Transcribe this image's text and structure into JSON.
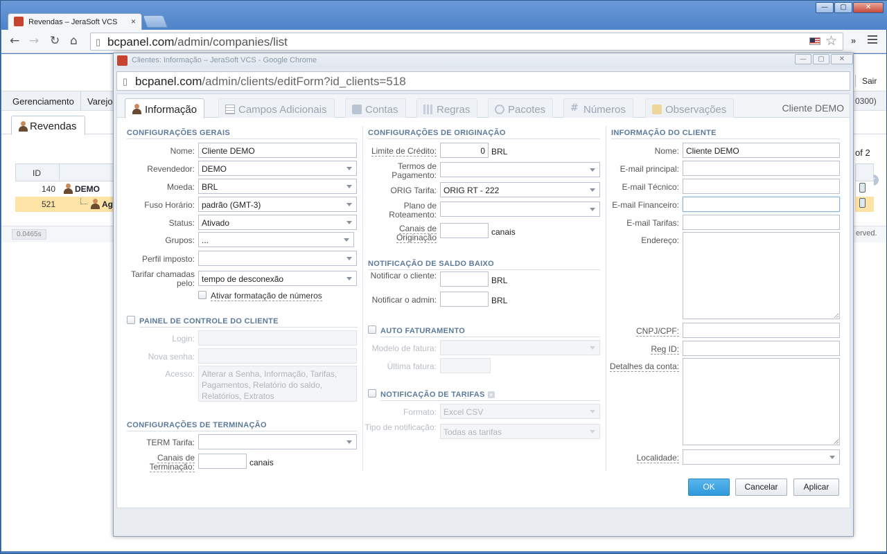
{
  "browser": {
    "tab_title": "Revendas – JeraSoft VCS",
    "url_host": "bcpanel.com",
    "url_path": "/admin/companies/list",
    "window_buttons": [
      "—",
      "▢",
      "✕"
    ]
  },
  "background_page": {
    "logout": "Sair",
    "menu": [
      "Gerenciamento",
      "Varejo"
    ],
    "right_code": "0300)",
    "tab": "Revendas",
    "pagination_tail": "of 2",
    "table": {
      "header_id": "ID",
      "rows": [
        {
          "id": "140",
          "name": "DEMO"
        },
        {
          "id": "521",
          "name": "Ag"
        }
      ]
    },
    "time": "0.0465s",
    "footer_right": "erved."
  },
  "popup": {
    "title": "Clientes: Informação – JeraSoft VCS - Google Chrome",
    "url_host": "bcpanel.com",
    "url_path": "/admin/clients/editForm?id_clients=518",
    "client_name": "Cliente DEMO",
    "tabs": [
      "Informação",
      "Campos Adicionais",
      "Contas",
      "Regras",
      "Pacotes",
      "Números",
      "Observações"
    ],
    "general": {
      "title": "CONFIGURAÇÕES GERAIS",
      "name_label": "Nome:",
      "name_value": "Cliente DEMO",
      "reseller_label": "Revendedor:",
      "reseller_value": "DEMO",
      "currency_label": "Moeda:",
      "currency_value": "BRL",
      "tz_label": "Fuso Horário:",
      "tz_value": "padrão (GMT-3)",
      "status_label": "Status:",
      "status_value": "Ativado",
      "groups_label": "Grupos:",
      "groups_value": "...",
      "tax_label": "Perfil imposto:",
      "tax_value": "",
      "billing_label": "Tarifar chamadas pelo:",
      "billing_value": "tempo de desconexão",
      "format_checkbox": "Ativar formatação de números"
    },
    "panel": {
      "title": "PAINEL DE CONTROLE DO CLIENTE",
      "login_label": "Login:",
      "password_label": "Nova senha:",
      "access_label": "Acesso:",
      "access_value": "Alterar a Senha, Informação, Tarifas, Pagamentos, Relatório do saldo, Relatórios, Extratos"
    },
    "termination": {
      "title": "CONFIGURAÇÕES DE TERMINAÇÃO",
      "rate_label": "TERM Tarifa:",
      "rate_value": "",
      "channels_label": "Canais de Terminação:",
      "channels_unit": "canais"
    },
    "origination": {
      "title": "CONFIGURAÇÕES DE ORIGINAÇÃO",
      "credit_label": "Limite de Crédito:",
      "credit_value": "0",
      "credit_unit": "BRL",
      "terms_label": "Termos de Pagamento:",
      "rate_label": "ORIG Tarifa:",
      "rate_value": "ORIG RT - 222",
      "routing_label": "Plano de Roteamento:",
      "channels_label": "Canais de Originação",
      "channels_unit": "canais"
    },
    "low_balance": {
      "title": "NOTIFICAÇÃO DE SALDO BAIXO",
      "notify_client_label": "Notificar o cliente:",
      "notify_client_unit": "BRL",
      "notify_admin_label": "Notificar o admin:",
      "notify_admin_unit": "BRL"
    },
    "auto_billing": {
      "title": "AUTO FATURAMENTO",
      "template_label": "Modelo de fatura:",
      "last_label": "Última fatura:"
    },
    "rate_notify": {
      "title": "NOTIFICAÇÃO DE TARIFAS",
      "format_label": "Formato:",
      "format_value": "Excel CSV",
      "type_label": "Tipo de notificação:",
      "type_value": "Todas as tarifas"
    },
    "client_info": {
      "title": "INFORMAÇÃO DO CLIENTE",
      "name_label": "Nome:",
      "name_value": "Cliente DEMO",
      "email_main_label": "E-mail principal:",
      "email_tech_label": "E-mail Técnico:",
      "email_fin_label": "E-mail Financeiro:",
      "email_rates_label": "E-mail Tarifas:",
      "address_label": "Endereço:",
      "cnpj_label": "CNPJ/CPF:",
      "regid_label": "Reg ID:",
      "account_label": "Detalhes da conta:",
      "locale_label": "Localidade:"
    },
    "buttons": {
      "ok": "OK",
      "cancel": "Cancelar",
      "apply": "Aplicar"
    }
  }
}
